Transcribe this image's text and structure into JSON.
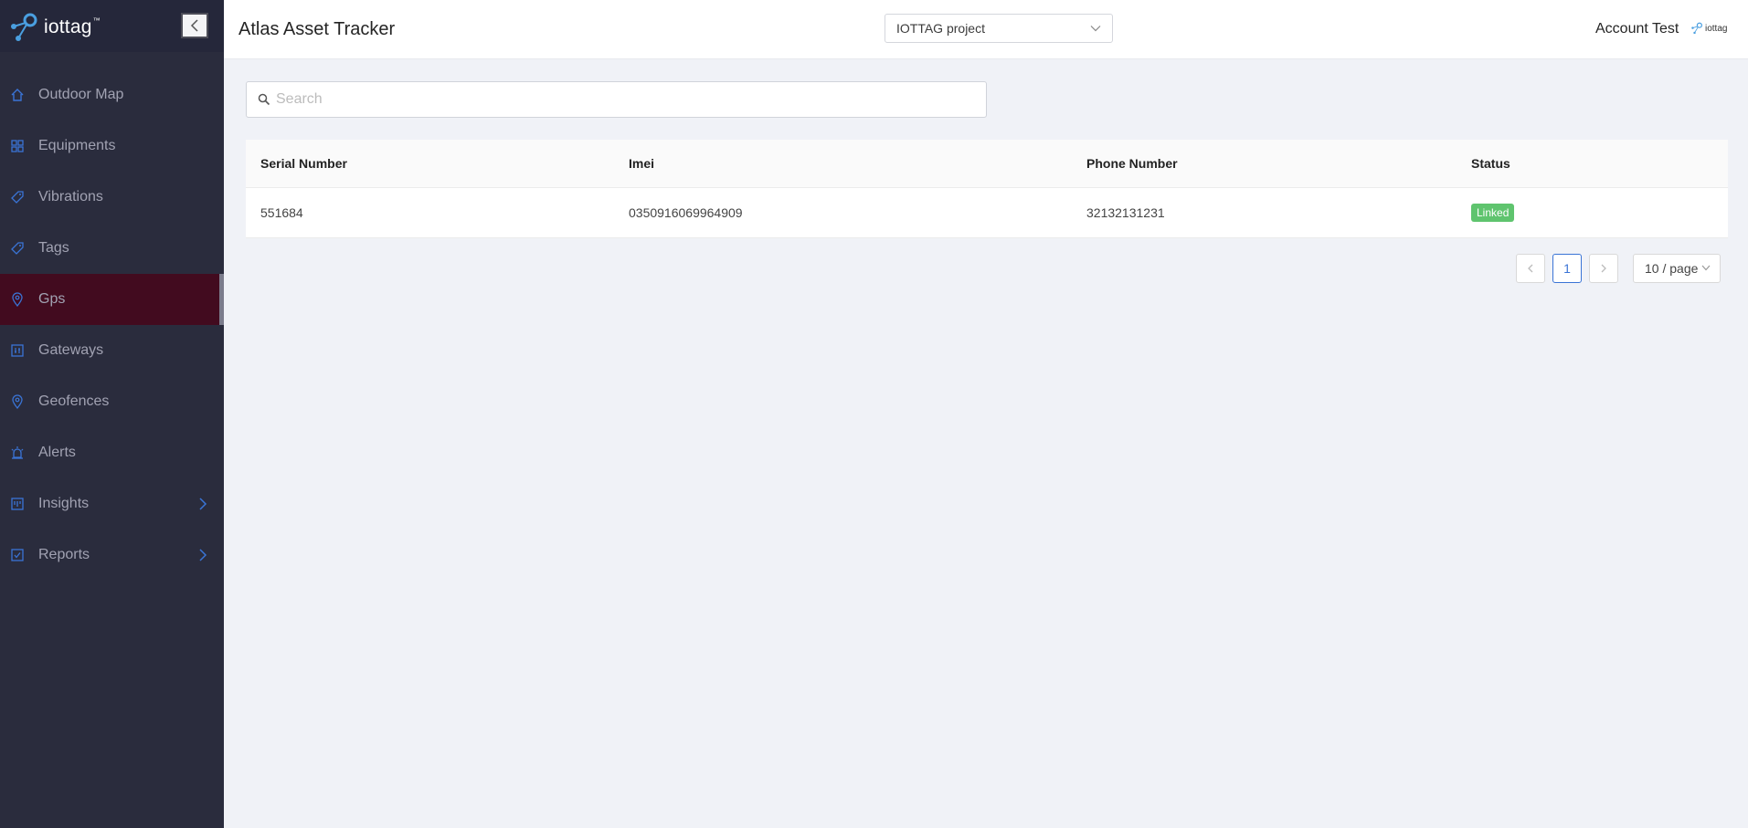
{
  "brand": {
    "name": "iottag",
    "tm": "™"
  },
  "sidebar": {
    "items": [
      {
        "label": "Outdoor Map",
        "icon": "home-icon"
      },
      {
        "label": "Equipments",
        "icon": "grid-icon"
      },
      {
        "label": "Vibrations",
        "icon": "tag-icon"
      },
      {
        "label": "Tags",
        "icon": "tags-icon"
      },
      {
        "label": "Gps",
        "icon": "location-pin-icon",
        "active": true
      },
      {
        "label": "Gateways",
        "icon": "gateway-icon"
      },
      {
        "label": "Geofences",
        "icon": "geofence-pin-icon"
      },
      {
        "label": "Alerts",
        "icon": "alarm-icon"
      },
      {
        "label": "Insights",
        "icon": "insights-icon",
        "expandable": true
      },
      {
        "label": "Reports",
        "icon": "report-check-icon",
        "expandable": true
      }
    ]
  },
  "header": {
    "title": "Atlas Asset Tracker",
    "project": "IOTTAG project",
    "account": "Account Test",
    "small_logo": "iottag"
  },
  "search": {
    "placeholder": "Search",
    "value": ""
  },
  "table": {
    "columns": [
      "Serial Number",
      "Imei",
      "Phone Number",
      "Status"
    ],
    "rows": [
      {
        "serial": "551684",
        "imei": "0350916069964909",
        "phone": "32132131231",
        "status": "Linked"
      }
    ]
  },
  "pagination": {
    "current": "1",
    "page_size": "10 / page"
  },
  "colors": {
    "sidebar_bg": "#2a2c3d",
    "active_bg": "#420b1f",
    "accent": "#3a74d6",
    "status_linked": "#5fc46e"
  }
}
